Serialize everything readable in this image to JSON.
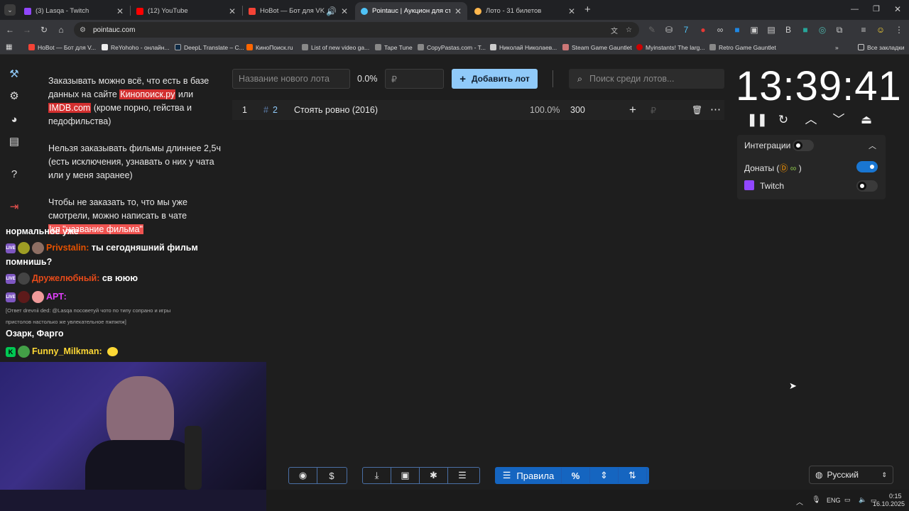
{
  "tabs": [
    {
      "title": "(3) Lasqa - Twitch",
      "color": "#9147ff"
    },
    {
      "title": "(12) YouTube",
      "color": "#ff0000"
    },
    {
      "title": "HoBot — Бот для VK Video",
      "color": "#f44336"
    },
    {
      "title": "Pointauc | Аукцион для стрим",
      "color": "#4fc3f7"
    },
    {
      "title": "Лото - 31 билетов",
      "color": "#ffb74d"
    }
  ],
  "new_tab": "+",
  "url": "pointauc.com",
  "bookmarks": [
    {
      "label": "HoBot — Бот для V...",
      "color": "#f44336"
    },
    {
      "label": "ReYohoho - онлайн...",
      "color": "#eee"
    },
    {
      "label": "DeepL Translate – C...",
      "color": "#0f2b46"
    },
    {
      "label": "КиноПоиск.ru",
      "color": "#f60"
    },
    {
      "label": "List of new video ga...",
      "color": "#888"
    },
    {
      "label": "Tape Tune",
      "color": "#888"
    },
    {
      "label": "CopyPastas.com - T...",
      "color": "#888"
    },
    {
      "label": "Николай Николаев...",
      "color": "#ccc"
    },
    {
      "label": "Steam Game Gauntlet",
      "color": "#c77"
    },
    {
      "label": "Myinstants! The larg...",
      "color": "#c00"
    },
    {
      "label": "Retro Game Gauntlet",
      "color": "#888"
    }
  ],
  "all_bookmarks": "Все закладки",
  "rules": {
    "p1_a": "Заказывать можно всё, что есть в базе данных на сайте ",
    "p1_link1": "Кинопоиск.ру",
    "p1_b": " или ",
    "p1_link2": "IMDB.com",
    "p1_c": " (кроме порно, гейства и педофильства)",
    "p2": "Нельзя заказывать фильмы длиннее 2,5ч (есть исключения, узнавать о них у чата или у меня заранее)",
    "p3": "Чтобы не заказать то, что мы уже смотрели, можно написать в чате",
    "p3_cmd": "!кп \"название фильма\""
  },
  "chat": [
    {
      "text": "нормальное уже"
    },
    {
      "user": "Privstalin:",
      "user_color": "#e65100",
      "text": "ты сегодняшний фильм"
    },
    {
      "text": "помнишь?"
    },
    {
      "user": "Дружелюбный:",
      "user_color": "#e64a19",
      "text": "св ююю"
    },
    {
      "user": "АРТ:",
      "user_color": "#e040fb",
      "text": ""
    },
    {
      "reply": "[Ответ drevnii ded: @Lasqa посоветуй чото по типу сопрано и игры"
    },
    {
      "reply": "пристолов настолько же увлекательное пжпжпж]"
    },
    {
      "text": "Озарк, Фарго"
    },
    {
      "user": "Funny_Milkman:",
      "user_color": "#fdd835",
      "text": ""
    }
  ],
  "lot_input": {
    "placeholder": "Название нового лота",
    "percent": "0.0%",
    "amount_placeholder": "₽"
  },
  "add_lot": "Добавить лот",
  "search_placeholder": "Поиск среди лотов...",
  "lots": [
    {
      "index": "1",
      "id": "2",
      "name": "Стоять ровно (2016)",
      "percent": "100.0%",
      "amount": "300",
      "currency": "₽"
    }
  ],
  "timer": "13:39:41",
  "integrations": {
    "title": "Интеграции",
    "donations_label": "Донаты (",
    "donations_close": ")",
    "twitch_label": "Twitch"
  },
  "bottom": {
    "rules_label": "Правила",
    "percent_symbol": "%"
  },
  "language": "Русский",
  "taskbar": {
    "lang": "ENG",
    "time": "0:15",
    "date": "16.10.2025"
  }
}
